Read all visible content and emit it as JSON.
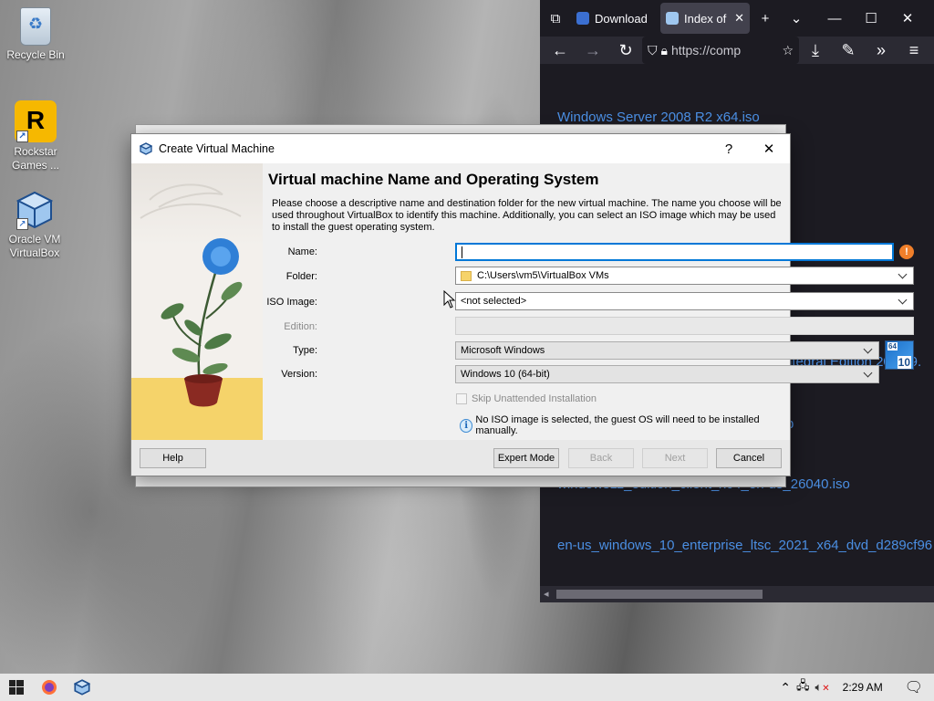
{
  "desktop": {
    "icons": [
      {
        "label": "Recycle Bin"
      },
      {
        "label": "Rockstar Games ..."
      },
      {
        "label": "Oracle VM VirtualBox"
      }
    ]
  },
  "browser": {
    "tabs": [
      {
        "label": "Download"
      },
      {
        "label": "Index of"
      }
    ],
    "url": "https://comp",
    "links": [
      "Windows Server 2008 R2 x64.iso",
      "ntegral Edition 2022.9.",
      "p",
      "windows11_edition_client_x64_en-us_26040.iso",
      "en-us_windows_10_enterprise_ltsc_2021_x64_dvd_d289cf96"
    ]
  },
  "dialog": {
    "title": "Create Virtual Machine",
    "help_glyph": "?",
    "close_glyph": "✕",
    "heading": "Virtual machine Name and Operating System",
    "description": "Please choose a descriptive name and destination folder for the new virtual machine. The name you choose will be used throughout VirtualBox to identify this machine. Additionally, you can select an ISO image which may be used to install the guest operating system.",
    "labels": {
      "name": "Name:",
      "folder": "Folder:",
      "iso": "ISO Image:",
      "edition": "Edition:",
      "type": "Type:",
      "version": "Version:"
    },
    "values": {
      "name": "",
      "folder": "C:\\Users\\vm5\\VirtualBox VMs",
      "iso": "<not selected>",
      "edition": "",
      "type": "Microsoft Windows",
      "version": "Windows 10 (64-bit)"
    },
    "os_badge": {
      "top": "64",
      "bottom": "10"
    },
    "skip_unattended": "Skip Unattended Installation",
    "info_message": "No ISO image is selected, the guest OS will need to be installed manually.",
    "buttons": {
      "help": "Help",
      "expert": "Expert Mode",
      "back": "Back",
      "next": "Next",
      "cancel": "Cancel"
    }
  },
  "taskbar": {
    "time": "2:29 AM"
  },
  "colors": {
    "link": "#4b8fe3",
    "browser_bg": "#1c1b22",
    "focus": "#0078d7",
    "warning": "#f07f2a"
  }
}
